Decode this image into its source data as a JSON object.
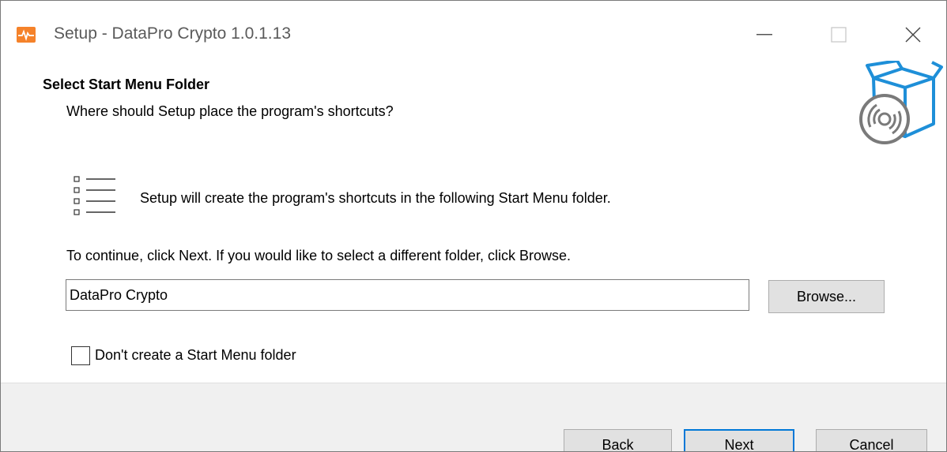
{
  "window": {
    "title": "Setup - DataPro Crypto 1.0.1.13",
    "accent_color": "#f5822a"
  },
  "header": {
    "title": "Select Start Menu Folder",
    "subtitle": "Where should Setup place the program's shortcuts?",
    "graphic_icon": "box-disc-icon"
  },
  "body": {
    "info_text": "Setup will create the program's shortcuts in the following Start Menu folder.",
    "instruction_text": "To continue, click Next. If you would like to select a different folder, click Browse.",
    "folder_value": "DataPro Crypto",
    "browse_label": "Browse...",
    "no_folder_label": "Don't create a Start Menu folder",
    "no_folder_checked": false
  },
  "footer": {
    "back_label": "Back",
    "next_label": "Next",
    "cancel_label": "Cancel",
    "default_button_color": "#0078d7"
  }
}
